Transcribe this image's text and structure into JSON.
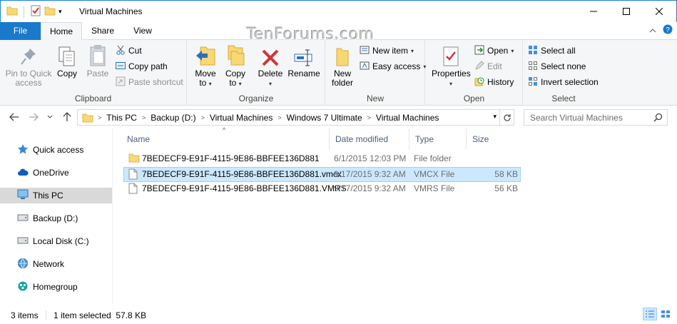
{
  "window": {
    "title": "Virtual Machines",
    "watermark": "TenForums.com"
  },
  "tabs": {
    "file": "File",
    "home": "Home",
    "share": "Share",
    "view": "View"
  },
  "ribbon": {
    "clipboard": {
      "label": "Clipboard",
      "pin_line1": "Pin to Quick",
      "pin_line2": "access",
      "copy": "Copy",
      "paste": "Paste",
      "cut": "Cut",
      "copy_path": "Copy path",
      "paste_shortcut": "Paste shortcut"
    },
    "organize": {
      "label": "Organize",
      "move_line1": "Move",
      "move_line2": "to",
      "copy_line1": "Copy",
      "copy_line2": "to",
      "delete": "Delete",
      "rename": "Rename"
    },
    "new": {
      "label": "New",
      "new_folder_line1": "New",
      "new_folder_line2": "folder",
      "new_item": "New item",
      "easy_access": "Easy access"
    },
    "open": {
      "label": "Open",
      "properties": "Properties",
      "open": "Open",
      "edit": "Edit",
      "history": "History"
    },
    "select": {
      "label": "Select",
      "select_all": "Select all",
      "select_none": "Select none",
      "invert": "Invert selection"
    }
  },
  "address": {
    "crumbs": [
      "This PC",
      "Backup (D:)",
      "Virtual Machines",
      "Windows 7 Ultimate",
      "Virtual Machines"
    ],
    "search_placeholder": "Search Virtual Machines"
  },
  "navpane": {
    "items": [
      {
        "label": "Quick access",
        "icon": "star-icon"
      },
      {
        "label": "OneDrive",
        "icon": "cloud-icon"
      },
      {
        "label": "This PC",
        "icon": "computer-icon"
      },
      {
        "label": "Backup (D:)",
        "icon": "drive-icon"
      },
      {
        "label": "Local Disk (C:)",
        "icon": "drive-icon"
      },
      {
        "label": "Network",
        "icon": "network-icon"
      },
      {
        "label": "Homegroup",
        "icon": "homegroup-icon"
      }
    ]
  },
  "filelist": {
    "columns": [
      "Name",
      "Date modified",
      "Type",
      "Size"
    ],
    "rows": [
      {
        "name": "7BEDECF9-E91F-4115-9E86-BBFEE136D881",
        "date": "6/1/2015 12:03 PM",
        "type": "File folder",
        "size": "",
        "icon": "folder-icon"
      },
      {
        "name": "7BEDECF9-E91F-4115-9E86-BBFEE136D881.vmcx",
        "date": "9/17/2015 9:32 AM",
        "type": "VMCX File",
        "size": "58 KB",
        "icon": "file-icon"
      },
      {
        "name": "7BEDECF9-E91F-4115-9E86-BBFEE136D881.VMRS",
        "date": "9/17/2015 9:32 AM",
        "type": "VMRS File",
        "size": "56 KB",
        "icon": "file-icon"
      }
    ]
  },
  "status": {
    "count": "3 items",
    "selected": "1 item selected  57.8 KB"
  },
  "colors": {
    "accent": "#1979ca",
    "selection": "#cce8ff",
    "folder": "#f8d775"
  }
}
